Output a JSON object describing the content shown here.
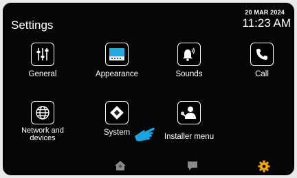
{
  "header": {
    "title": "Settings",
    "date": "20 MAR 2024",
    "time": "11:23 AM"
  },
  "tiles": [
    {
      "label": "General",
      "icon": "sliders-icon"
    },
    {
      "label": "Appearance",
      "icon": "display-icon"
    },
    {
      "label": "Sounds",
      "icon": "bell-icon"
    },
    {
      "label": "Call",
      "icon": "phone-icon"
    },
    {
      "label_line1": "Network and",
      "label_line2": "devices",
      "icon": "globe-icon"
    },
    {
      "label": "System",
      "icon": "chip-icon"
    },
    {
      "label": "Installer menu",
      "icon": "installer-icon"
    }
  ],
  "overlay": {
    "icon": "pointing-hand-icon",
    "color": "#1aa3dc"
  },
  "bottom_nav": [
    {
      "icon": "home-icon",
      "color": "#8a8a8a"
    },
    {
      "icon": "message-icon",
      "color": "#8a8a8a"
    },
    {
      "icon": "gear-icon",
      "color": "#f2a310",
      "active": true
    }
  ]
}
